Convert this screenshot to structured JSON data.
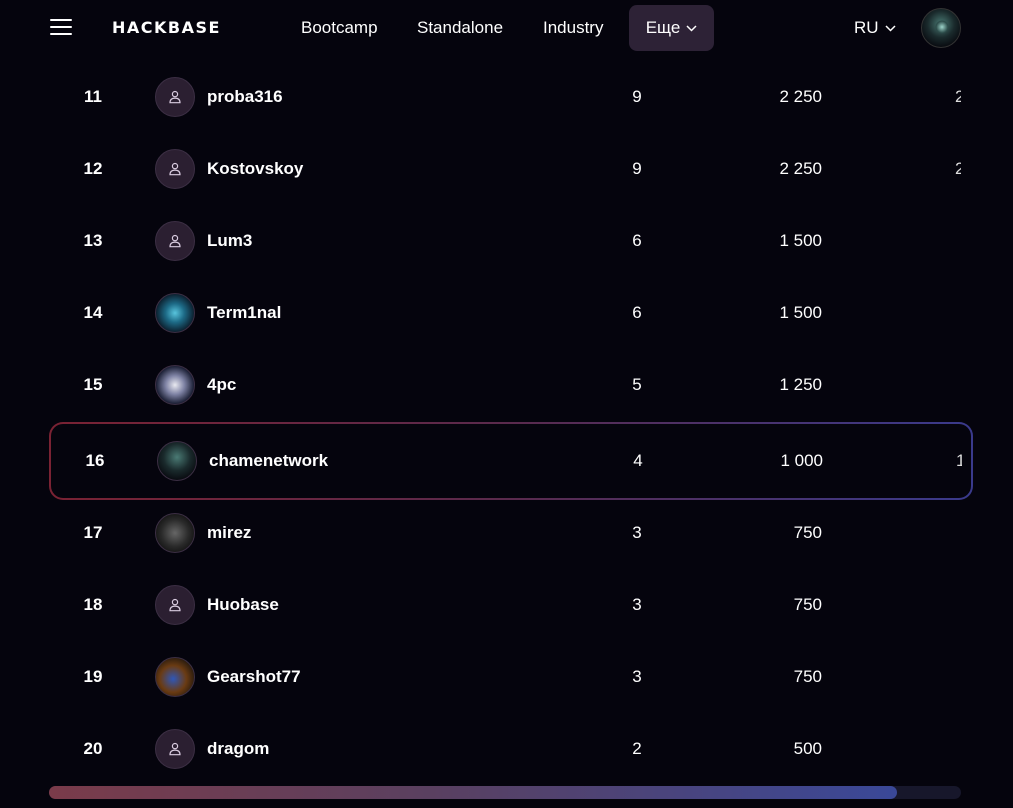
{
  "header": {
    "logo": "HACKBASE",
    "nav": [
      "Bootcamp",
      "Standalone",
      "Industry"
    ],
    "more_label": "Еще",
    "lang": "RU"
  },
  "leaderboard": {
    "rows": [
      {
        "rank": "11",
        "name": "proba316",
        "tasks": "9",
        "points": "2 250",
        "clipped": "2",
        "avatar": "default-user-icon"
      },
      {
        "rank": "12",
        "name": "Kostovskoy",
        "tasks": "9",
        "points": "2 250",
        "clipped": "2",
        "avatar": "default-user-icon"
      },
      {
        "rank": "13",
        "name": "Lum3",
        "tasks": "6",
        "points": "1 500",
        "clipped": "",
        "avatar": "default-user-icon"
      },
      {
        "rank": "14",
        "name": "Term1nal",
        "tasks": "6",
        "points": "1 500",
        "clipped": "",
        "avatar": "photo"
      },
      {
        "rank": "15",
        "name": "4pc",
        "tasks": "5",
        "points": "1 250",
        "clipped": "",
        "avatar": "photo"
      },
      {
        "rank": "16",
        "name": "chamenetwork",
        "tasks": "4",
        "points": "1 000",
        "clipped": "1",
        "avatar": "photo",
        "current": true
      },
      {
        "rank": "17",
        "name": "mirez",
        "tasks": "3",
        "points": "750",
        "clipped": "",
        "avatar": "photo"
      },
      {
        "rank": "18",
        "name": "Huobase",
        "tasks": "3",
        "points": "750",
        "clipped": "",
        "avatar": "default-user-icon"
      },
      {
        "rank": "19",
        "name": "Gearshot77",
        "tasks": "3",
        "points": "750",
        "clipped": "",
        "avatar": "photo"
      },
      {
        "rank": "20",
        "name": "dragom",
        "tasks": "2",
        "points": "500",
        "clipped": "",
        "avatar": "default-user-icon"
      }
    ]
  },
  "scroll": {
    "position_fraction": 0.0,
    "thumb_fraction": 0.93
  },
  "colors": {
    "background": "#05040d",
    "accent_button": "#2d2236",
    "highlight_start": "#7a2233",
    "highlight_end": "#3a3a8c"
  }
}
